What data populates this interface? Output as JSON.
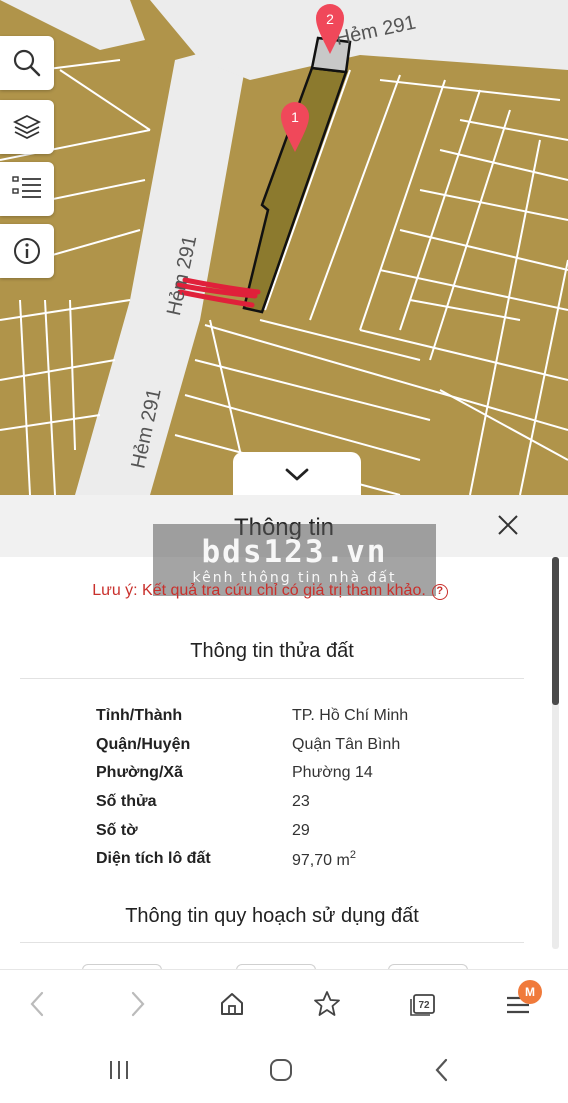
{
  "map": {
    "street_top": "Hẻm 291",
    "street_left_upper": "Hẻm 291",
    "street_left_lower": "Hẻm 291",
    "marker_1": "1",
    "marker_2": "2",
    "tools": [
      {
        "name": "search-icon"
      },
      {
        "name": "layers-icon"
      },
      {
        "name": "list-icon"
      },
      {
        "name": "info-icon"
      }
    ],
    "colors": {
      "parcel": "#b0944a",
      "road": "#ececec",
      "selected_parcel": "#8c7a2e",
      "marker": "#f0485a"
    }
  },
  "panel": {
    "title": "Thông tin",
    "notice": "Lưu ý: Kết quả tra cứu chỉ có giá trị tham khảo.",
    "section_parcel": "Thông tin thửa đất",
    "rows": [
      {
        "label": "Tỉnh/Thành",
        "value": "TP. Hồ Chí Minh"
      },
      {
        "label": "Quận/Huyện",
        "value": "Quận Tân Bình"
      },
      {
        "label": "Phường/Xã",
        "value": "Phường 14"
      },
      {
        "label": "Số thửa",
        "value": "23"
      },
      {
        "label": "Số tờ",
        "value": "29"
      },
      {
        "label": "Diện tích lô đất",
        "value": "97,70 m",
        "unit_sup": "2"
      }
    ],
    "section_planning": "Thông tin quy hoạch sử dụng đất"
  },
  "watermark": {
    "brand": "bds123.vn",
    "tagline": "kênh thông tin nhà đất"
  },
  "browser": {
    "tab_count": "72",
    "menu_badge": "M",
    "accent_color": "#f07a3b"
  }
}
